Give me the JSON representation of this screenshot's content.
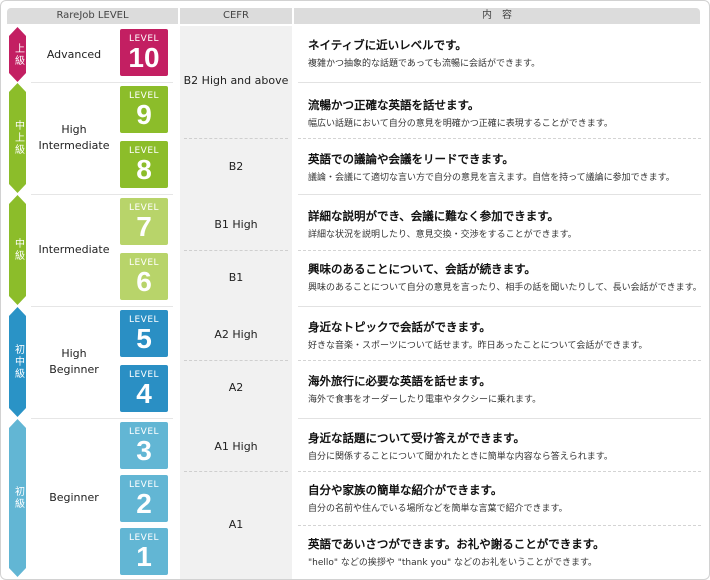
{
  "headers": {
    "level": "RareJob LEVEL",
    "cefr": "CEFR",
    "content": "内　容"
  },
  "colors": {
    "advanced": "#c31f62",
    "upper_intermediate": "#8cbd2a",
    "intermediate": "#8cbd2a",
    "pre_intermediate": "#2a93c6",
    "beginner": "#62b6d4",
    "level_10": "#c31f62",
    "level_9_8": "#8cbd2a",
    "level_7_6": "#b8d46a",
    "level_5_4": "#2a8fc4",
    "level_3_2_1": "#62b6d4"
  },
  "bands": {
    "advanced": "上級",
    "upper_intermediate": "中上級",
    "intermediate": "中級",
    "pre_intermediate": "初中級",
    "beginner": "初級"
  },
  "groups": {
    "advanced": "Advanced",
    "high_intermediate": "High\nIntermediate",
    "intermediate": "Intermediate",
    "high_beginner": "High\nBeginner",
    "beginner": "Beginner"
  },
  "level_label": "LEVEL",
  "levels": [
    "10",
    "9",
    "8",
    "7",
    "6",
    "5",
    "4",
    "3",
    "2",
    "1"
  ],
  "cefr": [
    "B2 High and above",
    "B2",
    "B1 High",
    "B1",
    "A2 High",
    "A2",
    "A1 High",
    "A1"
  ],
  "descriptions": [
    {
      "h": "ネイティブに近いレベルです。",
      "s": "複雑かつ抽象的な話題であっても流暢に会話ができます。"
    },
    {
      "h": "流暢かつ正確な英語を話せます。",
      "s": "幅広い話題において自分の意見を明確かつ正確に表現することができます。"
    },
    {
      "h": "英語での議論や会議をリードできます。",
      "s": "議論・会議にて適切な言い方で自分の意見を言えます。自信を持って議論に参加できます。"
    },
    {
      "h": "詳細な説明ができ、会議に難なく参加できます。",
      "s": "詳細な状況を説明したり、意見交換・交渉をすることができます。"
    },
    {
      "h": "興味のあることについて、会話が続きます。",
      "s": "興味のあることについて自分の意見を言ったり、相手の話を聞いたりして、長い会話ができます。"
    },
    {
      "h": "身近なトピックで会話ができます。",
      "s": "好きな音楽・スポーツについて話せます。昨日あったことについて会話ができます。"
    },
    {
      "h": "海外旅行に必要な英語を話せます。",
      "s": "海外で食事をオーダーしたり電車やタクシーに乗れます。"
    },
    {
      "h": "身近な話題について受け答えができます。",
      "s": "自分に関係することについて聞かれたときに簡単な内容なら答えられます。"
    },
    {
      "h": "自分や家族の簡単な紹介ができます。",
      "s": "自分の名前や住んでいる場所などを簡単な言葉で紹介できます。"
    },
    {
      "h": "英語であいさつができます。お礼や謝ることができます。",
      "s": "\"hello\" などの挨拶や \"thank you\" などのお礼をいうことができます。"
    }
  ]
}
